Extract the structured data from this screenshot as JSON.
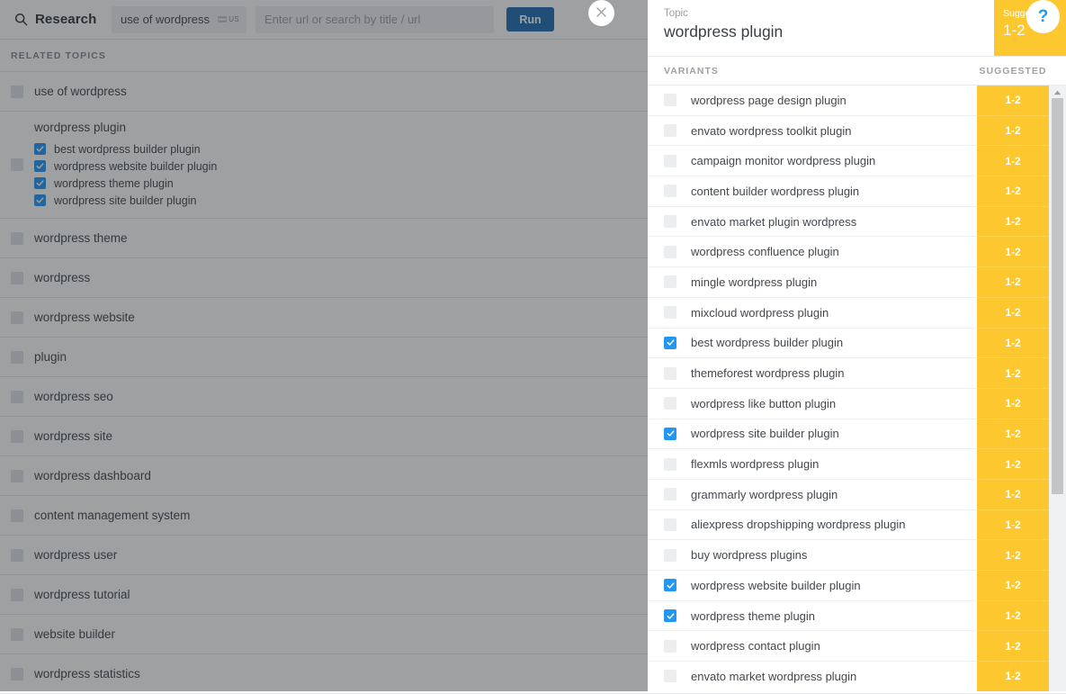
{
  "topbar": {
    "brand": "Research",
    "search_icon": "search-icon",
    "keyword_value": "use of wordpress",
    "locale": "US",
    "locale_flag": "us-flag-icon",
    "url_placeholder": "Enter url or search by title / url",
    "url_value": "",
    "run_label": "Run"
  },
  "close_button": {
    "icon": "close-icon",
    "label": "✕"
  },
  "related": {
    "section_label": "RELATED TOPICS",
    "items": [
      {
        "label": "use of wordpress",
        "checked": false,
        "children": []
      },
      {
        "label": "wordpress plugin",
        "checked": false,
        "children": [
          {
            "label": "best wordpress builder plugin",
            "checked": true
          },
          {
            "label": "wordpress website builder plugin",
            "checked": true
          },
          {
            "label": "wordpress theme plugin",
            "checked": true
          },
          {
            "label": "wordpress site builder plugin",
            "checked": true
          }
        ]
      },
      {
        "label": "wordpress theme",
        "checked": false,
        "children": []
      },
      {
        "label": "wordpress",
        "checked": false,
        "children": []
      },
      {
        "label": "wordpress website",
        "checked": false,
        "children": []
      },
      {
        "label": "plugin",
        "checked": false,
        "children": []
      },
      {
        "label": "wordpress seo",
        "checked": false,
        "children": []
      },
      {
        "label": "wordpress site",
        "checked": false,
        "children": []
      },
      {
        "label": "wordpress dashboard",
        "checked": false,
        "children": []
      },
      {
        "label": "content management system",
        "checked": false,
        "children": []
      },
      {
        "label": "wordpress user",
        "checked": false,
        "children": []
      },
      {
        "label": "wordpress tutorial",
        "checked": false,
        "children": []
      },
      {
        "label": "website builder",
        "checked": false,
        "children": []
      },
      {
        "label": "wordpress statistics",
        "checked": false,
        "children": []
      }
    ]
  },
  "panel": {
    "kicker": "Topic",
    "title": "wordpress plugin",
    "badge_caption": "Suggested",
    "badge_value": "1-2",
    "help_label": "?",
    "col_variants": "VARIANTS",
    "col_suggested": "SUGGESTED",
    "accent_yellow": "#fdc82f",
    "accent_blue": "#2196f3",
    "variants": [
      {
        "label": "wordpress page design plugin",
        "checked": false,
        "suggested": "1-2"
      },
      {
        "label": "envato wordpress toolkit plugin",
        "checked": false,
        "suggested": "1-2"
      },
      {
        "label": "campaign monitor wordpress plugin",
        "checked": false,
        "suggested": "1-2"
      },
      {
        "label": "content builder wordpress plugin",
        "checked": false,
        "suggested": "1-2"
      },
      {
        "label": "envato market plugin wordpress",
        "checked": false,
        "suggested": "1-2"
      },
      {
        "label": "wordpress confluence plugin",
        "checked": false,
        "suggested": "1-2"
      },
      {
        "label": "mingle wordpress plugin",
        "checked": false,
        "suggested": "1-2"
      },
      {
        "label": "mixcloud wordpress plugin",
        "checked": false,
        "suggested": "1-2"
      },
      {
        "label": "best wordpress builder plugin",
        "checked": true,
        "suggested": "1-2"
      },
      {
        "label": "themeforest wordpress plugin",
        "checked": false,
        "suggested": "1-2"
      },
      {
        "label": "wordpress like button plugin",
        "checked": false,
        "suggested": "1-2"
      },
      {
        "label": "wordpress site builder plugin",
        "checked": true,
        "suggested": "1-2"
      },
      {
        "label": "flexmls wordpress plugin",
        "checked": false,
        "suggested": "1-2"
      },
      {
        "label": "grammarly wordpress plugin",
        "checked": false,
        "suggested": "1-2"
      },
      {
        "label": "aliexpress dropshipping wordpress plugin",
        "checked": false,
        "suggested": "1-2"
      },
      {
        "label": "buy wordpress plugins",
        "checked": false,
        "suggested": "1-2"
      },
      {
        "label": "wordpress website builder plugin",
        "checked": true,
        "suggested": "1-2"
      },
      {
        "label": "wordpress theme plugin",
        "checked": true,
        "suggested": "1-2"
      },
      {
        "label": "wordpress contact plugin",
        "checked": false,
        "suggested": "1-2"
      },
      {
        "label": "envato market wordpress plugin",
        "checked": false,
        "suggested": "1-2"
      }
    ],
    "scrollbar": {
      "up_icon": "caret-up-icon"
    }
  }
}
